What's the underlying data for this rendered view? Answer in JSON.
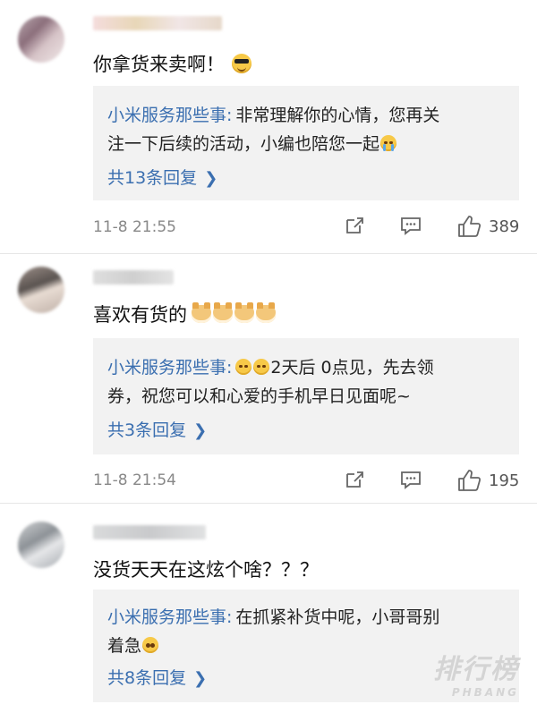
{
  "comments": [
    {
      "text": "你拿货来卖啊！",
      "emoji": "sunglasses-emoji",
      "reply": {
        "author": "小米服务那些事:",
        "line1": "非常理解你的心情，您再关",
        "line2": "注一下后续的活动，小编也陪您一起",
        "line2_emoji": "crying-face-emoji",
        "count": "共13条回复"
      },
      "time": "11-8 21:55",
      "likes": "389"
    },
    {
      "text": "喜欢有货的",
      "emoji": "doge-emoji",
      "emoji_count": 4,
      "reply": {
        "author": "小米服务那些事:",
        "line1_suffix": "2天后 0点见，先去领",
        "line1_emoji": "crying-face-emoji",
        "line1_emoji_count": 2,
        "line2": "券，祝您可以和心爱的手机早日见面呢~",
        "count": "共3条回复"
      },
      "time": "11-8 21:54",
      "likes": "195"
    },
    {
      "text": "没货天天在这炫个啥？？？",
      "reply": {
        "author": "小米服务那些事:",
        "line1": "在抓紧补货中呢，小哥哥别",
        "line2": "着急",
        "line2_emoji": "pleading-face-emoji",
        "count": "共8条回复"
      }
    }
  ],
  "colors": {
    "reply_author": "#3b6fb0",
    "reply_bg": "#f2f2f2",
    "meta_gray": "#888888"
  },
  "watermark": {
    "big": "排行榜",
    "small": "PHBANG"
  }
}
